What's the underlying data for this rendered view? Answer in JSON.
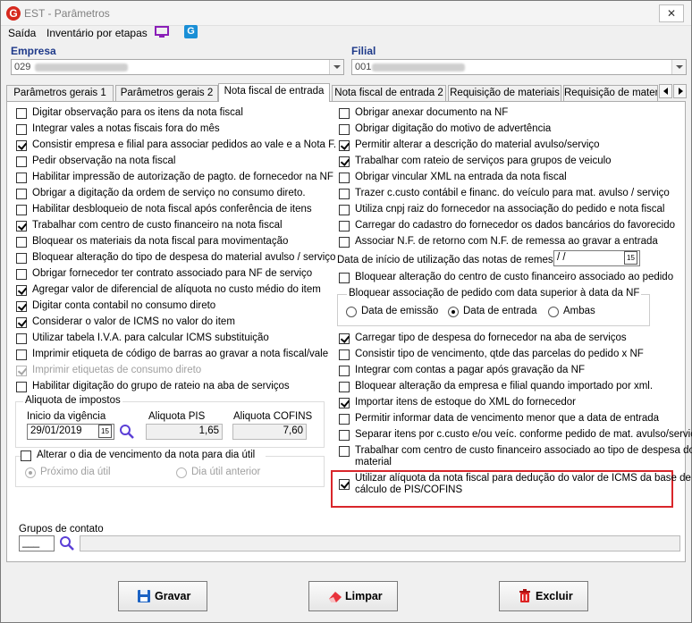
{
  "window": {
    "title": "EST - Parâmetros",
    "close_glyph": "✕",
    "logo_letter": "G",
    "g_icon_letter": "G"
  },
  "menu": {
    "items": [
      "Saída",
      "Inventário por etapas"
    ],
    "icons": [
      "monitor-icon",
      "g-app-icon"
    ]
  },
  "empresa": {
    "label": "Empresa",
    "code": "029"
  },
  "filial": {
    "label": "Filial",
    "code": "001"
  },
  "tabs": [
    "Parâmetros gerais 1",
    "Parâmetros gerais 2",
    "Nota fiscal de entrada",
    "Nota fiscal de entrada 2",
    "Requisição de materiais",
    "Requisição de materi"
  ],
  "active_tab": 2,
  "left_checks": [
    {
      "label": "Digitar observação para os itens da nota fiscal",
      "checked": false
    },
    {
      "label": "Integrar vales a notas fiscais fora do mês",
      "checked": false
    },
    {
      "label": "Consistir empresa e filial para associar pedidos ao vale e a Nota F.",
      "checked": true
    },
    {
      "label": "Pedir observação na nota fiscal",
      "checked": false
    },
    {
      "label": "Habilitar impressão de autorização de pagto. de fornecedor na NF",
      "checked": false
    },
    {
      "label": "Obrigar a digitação da ordem de serviço no consumo direto.",
      "checked": false
    },
    {
      "label": "Habilitar desbloqueio de nota fiscal após conferência de itens",
      "checked": false
    },
    {
      "label": "Trabalhar com centro de custo financeiro na nota fiscal",
      "checked": true
    },
    {
      "label": "Bloquear os materiais da nota fiscal para movimentação",
      "checked": false
    },
    {
      "label": "Bloquear alteração do tipo de despesa do material avulso / serviço",
      "checked": false
    },
    {
      "label": "Obrigar fornecedor ter contrato associado para NF de serviço",
      "checked": false
    },
    {
      "label": "Agregar valor de diferencial de alíquota no custo médio do item",
      "checked": true
    },
    {
      "label": "Digitar conta contabil no consumo direto",
      "checked": true
    },
    {
      "label": "Considerar o valor de ICMS no valor do item",
      "checked": true
    },
    {
      "label": "Utilizar tabela I.V.A. para calcular ICMS substituição",
      "checked": false
    },
    {
      "label": "Imprimir etiqueta de código de barras ao gravar a nota fiscal/vale",
      "checked": false
    },
    {
      "label": "Imprimir etiquetas de consumo direto",
      "checked": true,
      "disabled": true
    },
    {
      "label": "Habilitar digitação do grupo de rateio na aba de serviços",
      "checked": false
    }
  ],
  "aliquota": {
    "title": "Aliquota de impostos",
    "inicio_label": "Inicio da vigência",
    "inicio_value": "29/01/2019",
    "pis_label": "Aliquota PIS",
    "pis_value": "1,65",
    "cofins_label": "Aliquota COFINS",
    "cofins_value": "7,60",
    "cal_glyph": "15"
  },
  "vencimento": {
    "label": "Alterar o dia de vencimento da nota para dia útil",
    "checked": false,
    "options": [
      {
        "label": "Próximo dia útil",
        "selected": true
      },
      {
        "label": "Dia útil anterior",
        "selected": false
      }
    ]
  },
  "right_checks_a": [
    {
      "label": "Obrigar anexar documento na NF",
      "checked": false
    },
    {
      "label": "Obrigar digitação do motivo de advertência",
      "checked": false
    },
    {
      "label": "Permitir alterar a descrição do material avulso/serviço",
      "checked": true
    },
    {
      "label": "Trabalhar com rateio de serviços para grupos de veiculo",
      "checked": true
    },
    {
      "label": "Obrigar vincular XML na entrada da nota fiscal",
      "checked": false
    },
    {
      "label": "Trazer c.custo contábil e financ. do veículo para mat. avulso / serviço",
      "checked": false
    },
    {
      "label": "Utiliza cnpj raiz do fornecedor na associação do pedido e nota fiscal",
      "checked": false
    },
    {
      "label": "Carregar do cadastro do fornecedor os dados bancários do favorecido",
      "checked": false
    },
    {
      "label": "Associar N.F. de retorno com N.F. de remessa ao gravar a entrada",
      "checked": false
    }
  ],
  "data_inicio": {
    "label": "Data de início de utilização das notas de remessa",
    "value": " /  /",
    "cal_glyph": "15"
  },
  "bloquear_cc": {
    "label": "Bloquear alteração do centro de custo financeiro associado ao pedido",
    "checked": false
  },
  "bloquear_assoc": {
    "title": "Bloquear associação de pedido com data superior à data da NF",
    "options": [
      {
        "label": "Data de emissão",
        "selected": false
      },
      {
        "label": "Data de entrada",
        "selected": true
      },
      {
        "label": "Ambas",
        "selected": false
      }
    ]
  },
  "right_checks_b": [
    {
      "label": "Carregar tipo de despesa do fornecedor na aba de serviços",
      "checked": true
    },
    {
      "label": "Consistir tipo de vencimento, qtde das parcelas do pedido x NF",
      "checked": false
    },
    {
      "label": "Integrar com contas a pagar após gravação da NF",
      "checked": false
    },
    {
      "label": "Bloquear alteração da empresa e filial quando importado por xml.",
      "checked": false
    },
    {
      "label": "Importar itens de estoque do XML do fornecedor",
      "checked": true
    },
    {
      "label": "Permitir informar data de vencimento menor que a data de entrada",
      "checked": false
    },
    {
      "label": "Separar itens por c.custo e/ou veíc. conforme pedido de mat. avulso/serviço",
      "checked": false
    }
  ],
  "trabalhar_cc": {
    "label1": "Trabalhar com centro de custo financeiro associado ao tipo de despesa do",
    "label2": "material",
    "checked": false
  },
  "utilizar_aliq": {
    "label1": "Utilizar alíquota da nota fiscal para dedução do valor de ICMS da base de",
    "label2": "cálculo de PIS/COFINS",
    "checked": true
  },
  "grupos": {
    "label": "Grupos de contato",
    "value": "___"
  },
  "buttons": {
    "gravar": "Gravar",
    "limpar": "Limpar",
    "excluir": "Excluir"
  },
  "colors": {
    "accent": "#1f3a8a",
    "highlight": "#d9262b",
    "logo": "#d6281e"
  }
}
